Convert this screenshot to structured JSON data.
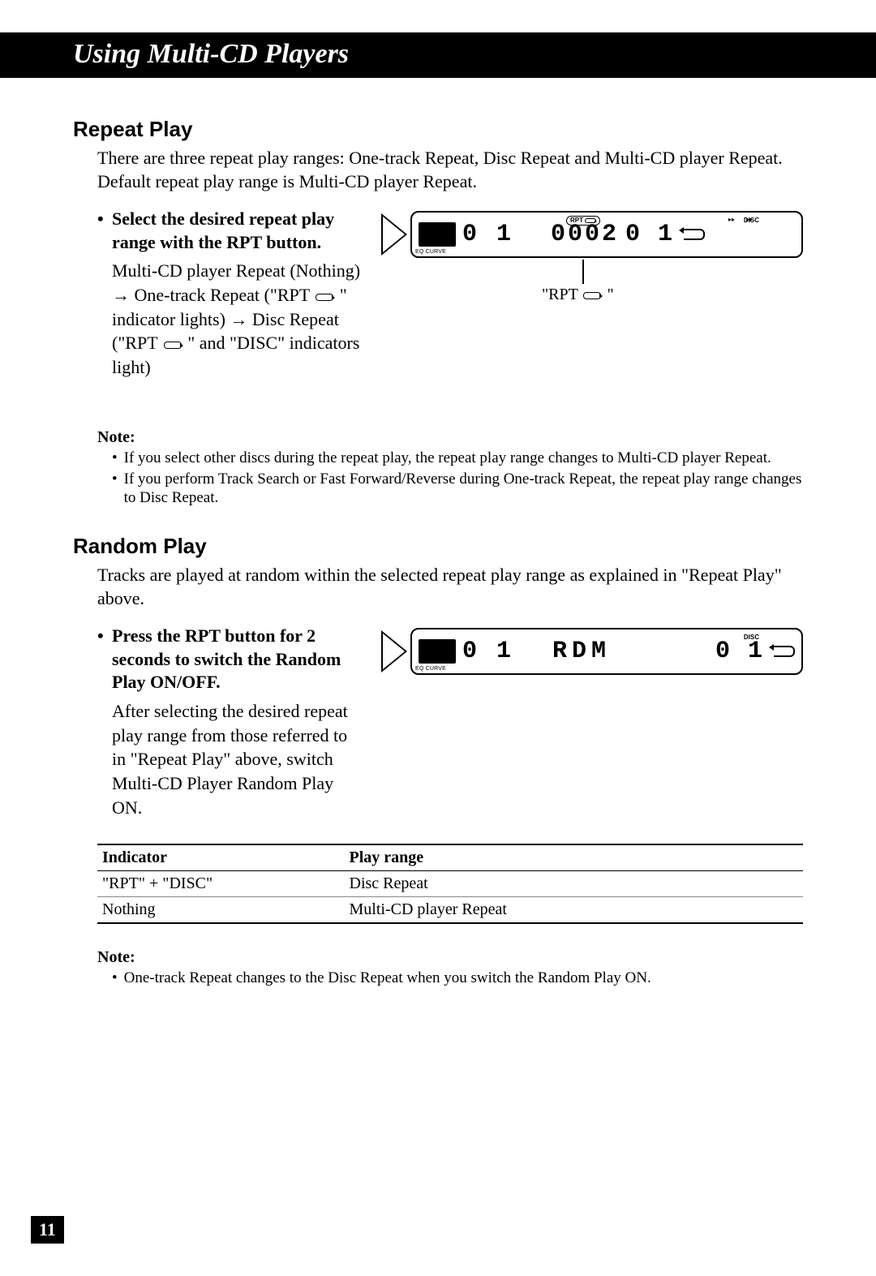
{
  "header": {
    "title": "Using Multi-CD Players"
  },
  "sections": {
    "repeat": {
      "heading": "Repeat Play",
      "intro": "There are three repeat play ranges: One-track Repeat, Disc Repeat and Multi-CD player Repeat. Default repeat play range is Multi-CD player Repeat.",
      "step_heading": "Select the desired repeat play range with the RPT button.",
      "step_body_a": "Multi-CD player Repeat (Nothing) → One-track Repeat (\"RPT ",
      "step_body_b": " \" indicator lights) → Disc Repeat (\"RPT ",
      "step_body_c": " \" and \"DISC\" indicators light)",
      "lcd": {
        "left": "0 1",
        "mid": "0002",
        "right": "0 1",
        "rpt": "RPT",
        "disc": "DISC",
        "callout": "\"RPT "
      },
      "note_hd": "Note:",
      "notes": [
        "If you select other discs during the repeat play, the repeat play range changes to Multi-CD player Repeat.",
        "If you perform Track Search or Fast Forward/Reverse during One-track Repeat, the repeat play range changes to Disc Repeat."
      ]
    },
    "random": {
      "heading": "Random Play",
      "intro": "Tracks are played at random within the selected repeat play range as explained in \"Repeat Play\" above.",
      "step_heading": "Press the RPT button for 2 seconds to switch the Random Play ON/OFF.",
      "step_body": "After selecting the desired repeat play range from those referred to in \"Repeat Play\" above, switch Multi-CD Player Random Play ON.",
      "lcd": {
        "left": "0 1",
        "mid": "RDM",
        "right": "0 1",
        "disc": "DISC"
      },
      "table": {
        "headers": [
          "Indicator",
          "Play range"
        ],
        "rows": [
          [
            "\"RPT\" + \"DISC\"",
            "Disc Repeat"
          ],
          [
            "Nothing",
            "Multi-CD player Repeat"
          ]
        ]
      },
      "note_hd": "Note:",
      "notes": [
        "One-track Repeat changes to the Disc Repeat when you switch the Random Play ON."
      ]
    }
  },
  "page": "11"
}
